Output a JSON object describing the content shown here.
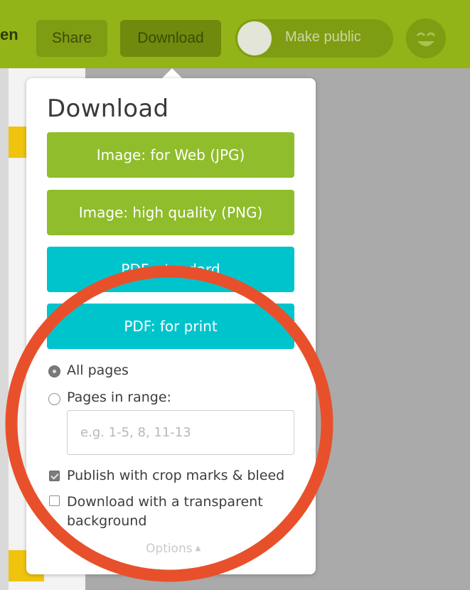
{
  "toolbar": {
    "edge_text": "en",
    "share_label": "Share",
    "download_label": "Download",
    "make_public_label": "Make public"
  },
  "panel": {
    "title": "Download",
    "buttons": [
      {
        "label": "Image: for Web (JPG)",
        "color": "#8fbd2b"
      },
      {
        "label": "Image: high quality (PNG)",
        "color": "#8fbd2b"
      },
      {
        "label": "PDF: standard",
        "color": "#00c4cc"
      },
      {
        "label": "PDF: for print",
        "color": "#00c4cc"
      }
    ],
    "page_options": {
      "all_pages_label": "All pages",
      "all_pages_selected": true,
      "range_label": "Pages in range:",
      "range_selected": false,
      "range_placeholder": "e.g. 1-5, 8, 11-13",
      "range_value": ""
    },
    "checkboxes": [
      {
        "label": "Publish with crop marks & bleed",
        "checked": true
      },
      {
        "label": "Download with a transparent background",
        "checked": false
      }
    ],
    "options_link": "Options"
  },
  "annotation": {
    "ring_color": "#e8502c"
  }
}
